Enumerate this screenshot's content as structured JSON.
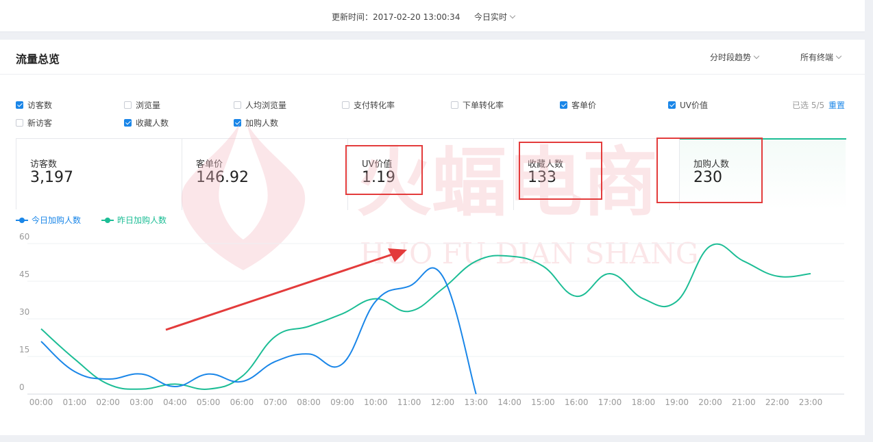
{
  "topbar": {
    "update_time": "更新时间：2017-02-20 13:00:34",
    "realtime_label": "今日实时"
  },
  "panel": {
    "title": "流量总览",
    "trend_dropdown": "分时段趋势",
    "terminal_dropdown": "所有终端"
  },
  "metrics": [
    {
      "label": "访客数",
      "checked": true
    },
    {
      "label": "浏览量",
      "checked": false
    },
    {
      "label": "人均浏览量",
      "checked": false
    },
    {
      "label": "支付转化率",
      "checked": false
    },
    {
      "label": "下单转化率",
      "checked": false
    },
    {
      "label": "客单价",
      "checked": true
    },
    {
      "label": "UV价值",
      "checked": true
    },
    {
      "label": "新访客",
      "checked": false
    },
    {
      "label": "收藏人数",
      "checked": true
    },
    {
      "label": "加购人数",
      "checked": true
    }
  ],
  "selection": {
    "count_text": "已选 5/5",
    "reset_label": "重置"
  },
  "cards": [
    {
      "label": "访客数",
      "value": "3,197"
    },
    {
      "label": "客单价",
      "value": "146.92"
    },
    {
      "label": "UV价值",
      "value": "1.19"
    },
    {
      "label": "收藏人数",
      "value": "133"
    },
    {
      "label": "加购人数",
      "value": "230"
    }
  ],
  "legend": {
    "today": "今日加购人数",
    "yesterday": "昨日加购人数"
  },
  "colors": {
    "accent": "#1a86e8",
    "today_line": "#1a86e8",
    "yesterday_line": "#1cbd95",
    "highlight": "#e33b3b",
    "watermark": "#f4b8bf"
  },
  "watermark": {
    "text": "火蝠电商",
    "subtext": "HUO FU DIAN SHANG"
  },
  "chart_data": {
    "type": "line",
    "x": [
      "00:00",
      "01:00",
      "02:00",
      "03:00",
      "04:00",
      "05:00",
      "06:00",
      "07:00",
      "08:00",
      "09:00",
      "10:00",
      "11:00",
      "12:00",
      "13:00",
      "14:00",
      "15:00",
      "16:00",
      "17:00",
      "18:00",
      "19:00",
      "20:00",
      "21:00",
      "22:00",
      "23:00"
    ],
    "series": [
      {
        "name": "今日加购人数",
        "color": "#1a86e8",
        "values": [
          21,
          9,
          6,
          8,
          3,
          8,
          5,
          13,
          16,
          12,
          37,
          43,
          47,
          0
        ]
      },
      {
        "name": "昨日加购人数",
        "color": "#1cbd95",
        "values": [
          26,
          14,
          4,
          2,
          4,
          2,
          7,
          23,
          27,
          32,
          38,
          33,
          42,
          53,
          55,
          51,
          39,
          48,
          38,
          37,
          59,
          53,
          47,
          48
        ]
      }
    ],
    "y_ticks": [
      0,
      15,
      30,
      45,
      60
    ],
    "ylim": [
      0,
      60
    ],
    "grid": true,
    "legend_position": "top-left"
  }
}
